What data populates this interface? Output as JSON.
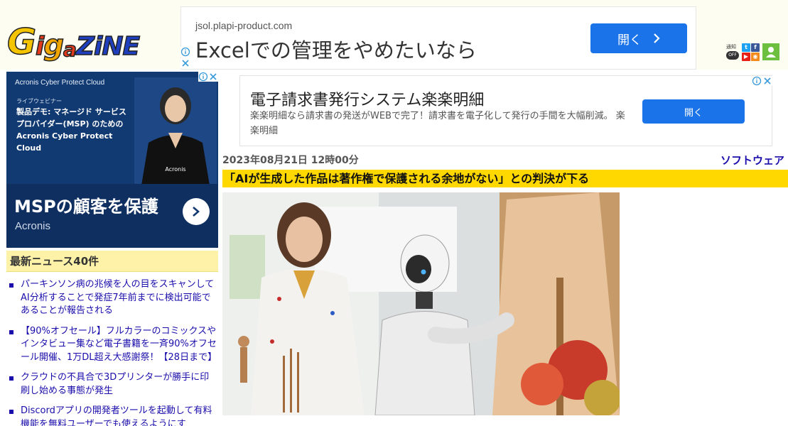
{
  "site": {
    "logo_text": "GIGAZINE"
  },
  "top_ad": {
    "url": "jsol.plapi-product.com",
    "headline": "Excelでの管理をやめたいなら",
    "button_label": "開く"
  },
  "left_ad": {
    "brand": "Acronis Cyber Protect Cloud",
    "sub": "ライブウェビナー",
    "demo": "製品デモ: マネージド サービスプロバイダー(MSP) のためのAcronis Cyber Protect Cloud",
    "big_text": "MSPの顧客を保護",
    "company": "Acronis",
    "shirt_logo": "Acronis"
  },
  "header_icons": {
    "notify_label": "通知",
    "notify_state": "OFF"
  },
  "news": {
    "heading": "最新ニュース40件",
    "items": [
      "パーキンソン病の兆候を人の目をスキャンしてAI分析することで発症7年前までに検出可能であることが報告される",
      "【90%オフセール】フルカラーのコミックスやインタビュー集など電子書籍を一斉90%オフセール開催、1万DL超え大感謝祭！【28日まで】",
      "クラウドの不具合で3Dプリンターが勝手に印刷し始める事態が発生",
      "Discordアプリの開発者ツールを起動して有料機能を無料ユーザーでも使えるようにす"
    ]
  },
  "main_ad": {
    "title": "電子請求書発行システム楽楽明細",
    "description": "楽楽明細なら請求書の発送がWEBで完了！請求書を電子化して発行の手間を大幅削減。 楽楽明細",
    "button_label": "開く"
  },
  "article": {
    "date": "2023年08月21日 12時00分",
    "category": "ソフトウェア",
    "headline": "「AIが生成した作品は著作権で保護される余地がない」との判決が下る"
  },
  "colors": {
    "link": "#1a0dab",
    "headline_bg": "#ffd800",
    "news_head_bg": "#fdf2a8",
    "ad_button": "#1a73e8",
    "left_ad_bg": "#123a72"
  }
}
